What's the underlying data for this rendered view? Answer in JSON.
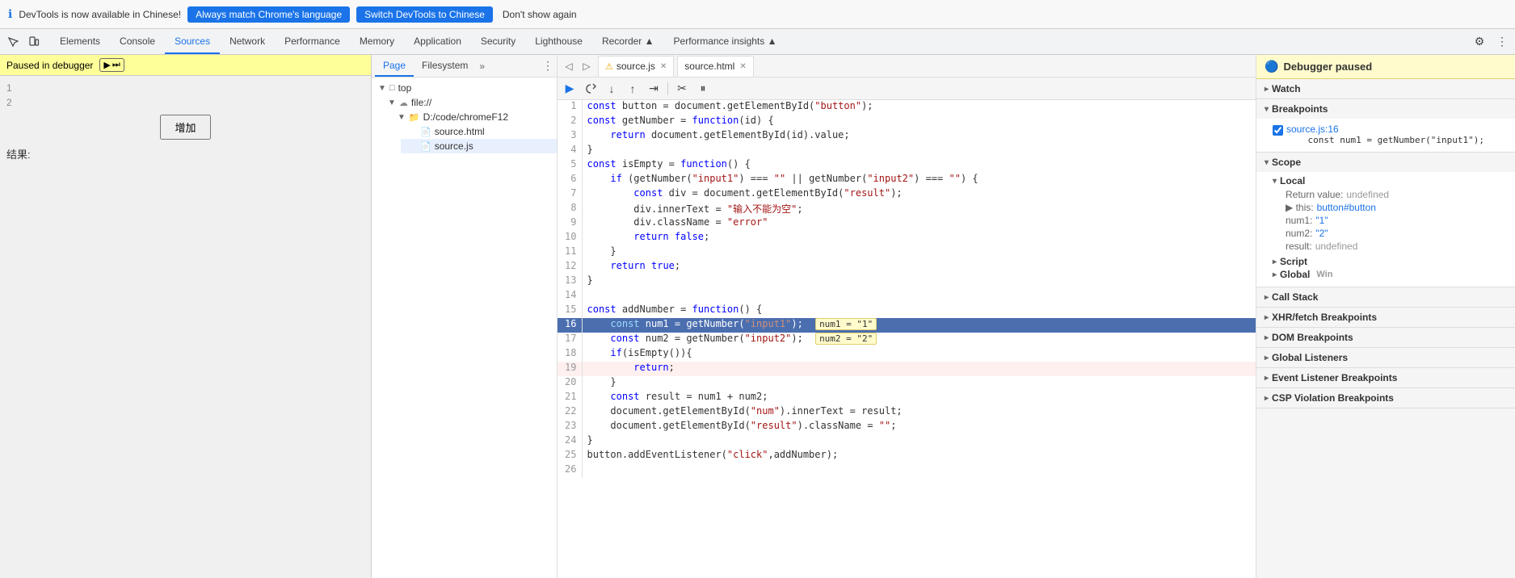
{
  "banner": {
    "text": "DevTools is now available in Chinese!",
    "btn1_label": "Always match Chrome's language",
    "btn2_label": "Switch DevTools to Chinese",
    "dont_show": "Don't show again",
    "info_icon": "ℹ"
  },
  "toolbar": {
    "tabs": [
      "Elements",
      "Console",
      "Sources",
      "Network",
      "Performance",
      "Memory",
      "Application",
      "Security",
      "Lighthouse",
      "Recorder ▲",
      "Performance insights ▲"
    ],
    "active_tab": "Sources",
    "settings_icon": "⚙"
  },
  "page_panel": {
    "tabs": [
      "Page",
      "Filesystem"
    ],
    "more_icon": "»",
    "tree": [
      {
        "label": "top",
        "level": 0,
        "type": "root",
        "arrow": "▼"
      },
      {
        "label": "file://",
        "level": 1,
        "type": "folder",
        "arrow": "▼"
      },
      {
        "label": "D:/code/chromeF12",
        "level": 2,
        "type": "folder",
        "arrow": "▼"
      },
      {
        "label": "source.html",
        "level": 3,
        "type": "html"
      },
      {
        "label": "source.js",
        "level": 3,
        "type": "js",
        "selected": true
      }
    ]
  },
  "sources_tabs": {
    "nav_icons": [
      "◁",
      "▷"
    ],
    "files": [
      {
        "name": "source.js",
        "has_warn": true,
        "active": true
      },
      {
        "name": "source.html",
        "has_warn": false,
        "active": false
      }
    ]
  },
  "debug_toolbar": {
    "buttons": [
      {
        "icon": "▶",
        "title": "Resume",
        "active": true,
        "name": "resume-btn"
      },
      {
        "icon": "⟳",
        "title": "Step over",
        "name": "step-over-btn"
      },
      {
        "icon": "↓",
        "title": "Step into",
        "name": "step-into-btn"
      },
      {
        "icon": "↑",
        "title": "Step out",
        "name": "step-out-btn"
      },
      {
        "icon": "⇥",
        "title": "Step",
        "name": "step-btn"
      },
      {
        "icon": "✂",
        "title": "Deactivate breakpoints",
        "name": "deactivate-bp-btn"
      },
      {
        "icon": "⏸",
        "title": "Pause on exceptions",
        "name": "pause-exceptions-btn"
      }
    ]
  },
  "code": {
    "lines": [
      {
        "num": 1,
        "content": "const button = document.getElementById(\"button\");",
        "highlight": false
      },
      {
        "num": 2,
        "content": "const getNumber = function(id) {",
        "highlight": false
      },
      {
        "num": 3,
        "content": "    return document.getElementById(id).value;",
        "highlight": false
      },
      {
        "num": 4,
        "content": "}",
        "highlight": false
      },
      {
        "num": 5,
        "content": "const isEmpty = function() {",
        "highlight": false
      },
      {
        "num": 6,
        "content": "    if (getNumber(\"input1\") === \"\" || getNumber(\"input2\") === \"\") {",
        "highlight": false
      },
      {
        "num": 7,
        "content": "        const div = document.getElementById(\"result\");",
        "highlight": false
      },
      {
        "num": 8,
        "content": "        div.innerText = \"输入不能为空\";",
        "highlight": false
      },
      {
        "num": 9,
        "content": "        div.className = \"error\"",
        "highlight": false
      },
      {
        "num": 10,
        "content": "        return false;",
        "highlight": false
      },
      {
        "num": 11,
        "content": "    }",
        "highlight": false
      },
      {
        "num": 12,
        "content": "    return true;",
        "highlight": false
      },
      {
        "num": 13,
        "content": "}",
        "highlight": false
      },
      {
        "num": 14,
        "content": "",
        "highlight": false
      },
      {
        "num": 15,
        "content": "const addNumber = function() {",
        "highlight": false
      },
      {
        "num": 16,
        "content": "    const num1 = getNumber(\"input1\");",
        "highlight": true,
        "tooltip1": "num1 = \"1\"",
        "tooltip2": null
      },
      {
        "num": 17,
        "content": "    const num2 = getNumber(\"input2\");",
        "highlight": false,
        "tooltip2": "num2 = \"2\""
      },
      {
        "num": 18,
        "content": "    if(isEmpty()){",
        "highlight": false
      },
      {
        "num": 19,
        "content": "        return;",
        "highlight": false,
        "error": true
      },
      {
        "num": 20,
        "content": "    }",
        "highlight": false
      },
      {
        "num": 21,
        "content": "    const result = num1 + num2;",
        "highlight": false
      },
      {
        "num": 22,
        "content": "    document.getElementById(\"num\").innerText = result;",
        "highlight": false
      },
      {
        "num": 23,
        "content": "    document.getElementById(\"result\").className = \"\";",
        "highlight": false
      },
      {
        "num": 24,
        "content": "}",
        "highlight": false
      },
      {
        "num": 25,
        "content": "button.addEventListener(\"click\",addNumber);",
        "highlight": false
      },
      {
        "num": 26,
        "content": "",
        "highlight": false
      }
    ]
  },
  "debugger_panel": {
    "header": "Debugger paused",
    "header_icon": "🔵",
    "sections": [
      {
        "label": "Watch",
        "open": false
      },
      {
        "label": "Breakpoints",
        "open": true,
        "items": [
          {
            "location": "source.js:16",
            "code": "    const num1 = getNumber(\"input1\");"
          }
        ]
      },
      {
        "label": "Scope",
        "open": true,
        "subsections": [
          {
            "label": "Local",
            "open": true,
            "items": [
              {
                "key": "Return value:",
                "value": "undefined"
              },
              {
                "key": "▶ this:",
                "value": "button#button",
                "clickable": true
              },
              {
                "key": "num1:",
                "value": "\"1\""
              },
              {
                "key": "num2:",
                "value": "\"2\""
              },
              {
                "key": "result:",
                "value": "undefined"
              }
            ]
          },
          {
            "label": "Script",
            "open": false
          },
          {
            "label": "Global",
            "open": false,
            "suffix": "Win"
          }
        ]
      },
      {
        "label": "Call Stack",
        "open": false
      },
      {
        "label": "XHR/fetch Breakpoints",
        "open": false
      },
      {
        "label": "DOM Breakpoints",
        "open": false
      },
      {
        "label": "Global Listeners",
        "open": false
      },
      {
        "label": "Event Listener Breakpoints",
        "open": false
      },
      {
        "label": "CSP Violation Breakpoints",
        "open": false
      }
    ]
  },
  "page_left": {
    "debugger_bar": "Paused in debugger",
    "rows": [
      {
        "num": "1",
        "label": ""
      },
      {
        "num": "2",
        "label": ""
      }
    ],
    "content_label": "增加",
    "result_label": "结果:"
  }
}
